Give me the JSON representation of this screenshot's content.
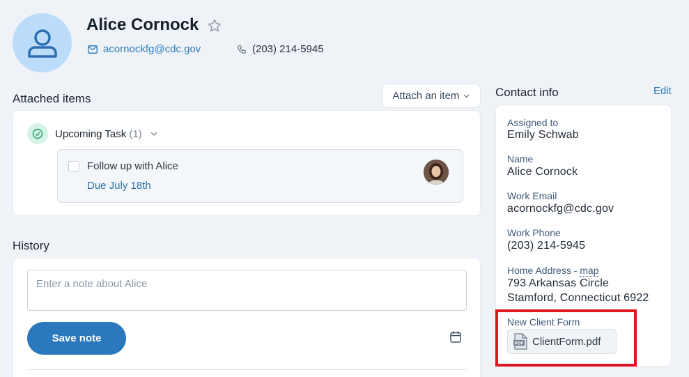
{
  "header": {
    "name": "Alice Cornock",
    "email": "acornockfg@cdc.gov",
    "phone": "(203) 214-5945"
  },
  "attached": {
    "heading": "Attached items",
    "attach_button": "Attach an item",
    "group_label": "Upcoming Task",
    "group_count": "(1)",
    "task_title": "Follow up with Alice",
    "task_due": "Due July 18th"
  },
  "history": {
    "heading": "History",
    "note_placeholder": "Enter a note about Alice",
    "save_button": "Save note"
  },
  "contact": {
    "heading": "Contact info",
    "edit": "Edit",
    "fields": [
      {
        "label": "Assigned to",
        "value": "Emily Schwab"
      },
      {
        "label": "Name",
        "value": "Alice Cornock"
      },
      {
        "label": "Work Email",
        "value": "acornockfg@cdc.gov"
      },
      {
        "label": "Work Phone",
        "value": "(203) 214-5945"
      }
    ],
    "address_label": "Home Address - ",
    "map_link": "map",
    "address_line1": "793 Arkansas Circle",
    "address_line2": "Stamford, Connecticut 6922",
    "form_label": "New Client Form",
    "form_file": "ClientForm.pdf"
  },
  "icons": {
    "avatar": "person-icon",
    "favorite": "star-icon",
    "email": "mail-icon",
    "phone": "phone-icon",
    "task_status": "check-circle-icon",
    "expand": "chevron-down-icon",
    "schedule": "calendar-icon",
    "file": "pdf-icon"
  },
  "colors": {
    "accent": "#2b78bd",
    "link": "#2c7bb8",
    "highlight": "#e0161f"
  }
}
